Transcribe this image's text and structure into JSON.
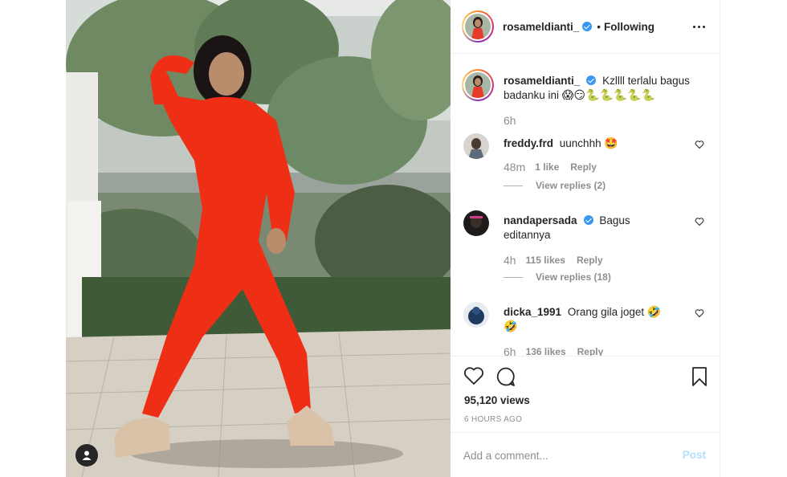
{
  "post": {
    "author": "rosameldianti_",
    "verified": true,
    "follow_separator": "•",
    "follow_state": "Following",
    "caption": "Kzllll terlalu bagus badanku ini",
    "caption_emojis": "😱😏🐍🐍🐍🐍🐍",
    "caption_time": "6h"
  },
  "comments": [
    {
      "username": "freddy.frd",
      "verified": false,
      "text": "uunchhh",
      "emoji": "🤩",
      "time": "48m",
      "likes": "1 like",
      "reply_label": "Reply",
      "view_replies": "View replies (2)"
    },
    {
      "username": "nandapersada",
      "verified": true,
      "text": "Bagus editannya",
      "emoji": "",
      "time": "4h",
      "likes": "115 likes",
      "reply_label": "Reply",
      "view_replies": "View replies (18)"
    },
    {
      "username": "dicka_1991",
      "verified": false,
      "text": "Orang gila joget",
      "emoji": "🤣 🤣",
      "time": "6h",
      "likes": "136 likes",
      "reply_label": "Reply",
      "view_replies": ""
    }
  ],
  "actions": {
    "views": "95,120 views",
    "timestamp": "6 HOURS AGO"
  },
  "comment_box": {
    "placeholder": "Add a comment...",
    "post_label": "Post"
  },
  "icons": {
    "like": "heart-outline-icon",
    "comment": "comment-bubble-icon",
    "save": "bookmark-icon",
    "more": "more-dots-icon",
    "user_tag": "user-tag-icon"
  },
  "colors": {
    "verified_blue": "#3897f0",
    "post_disabled": "#b2dffc",
    "muted_text": "#8e8e8e"
  }
}
